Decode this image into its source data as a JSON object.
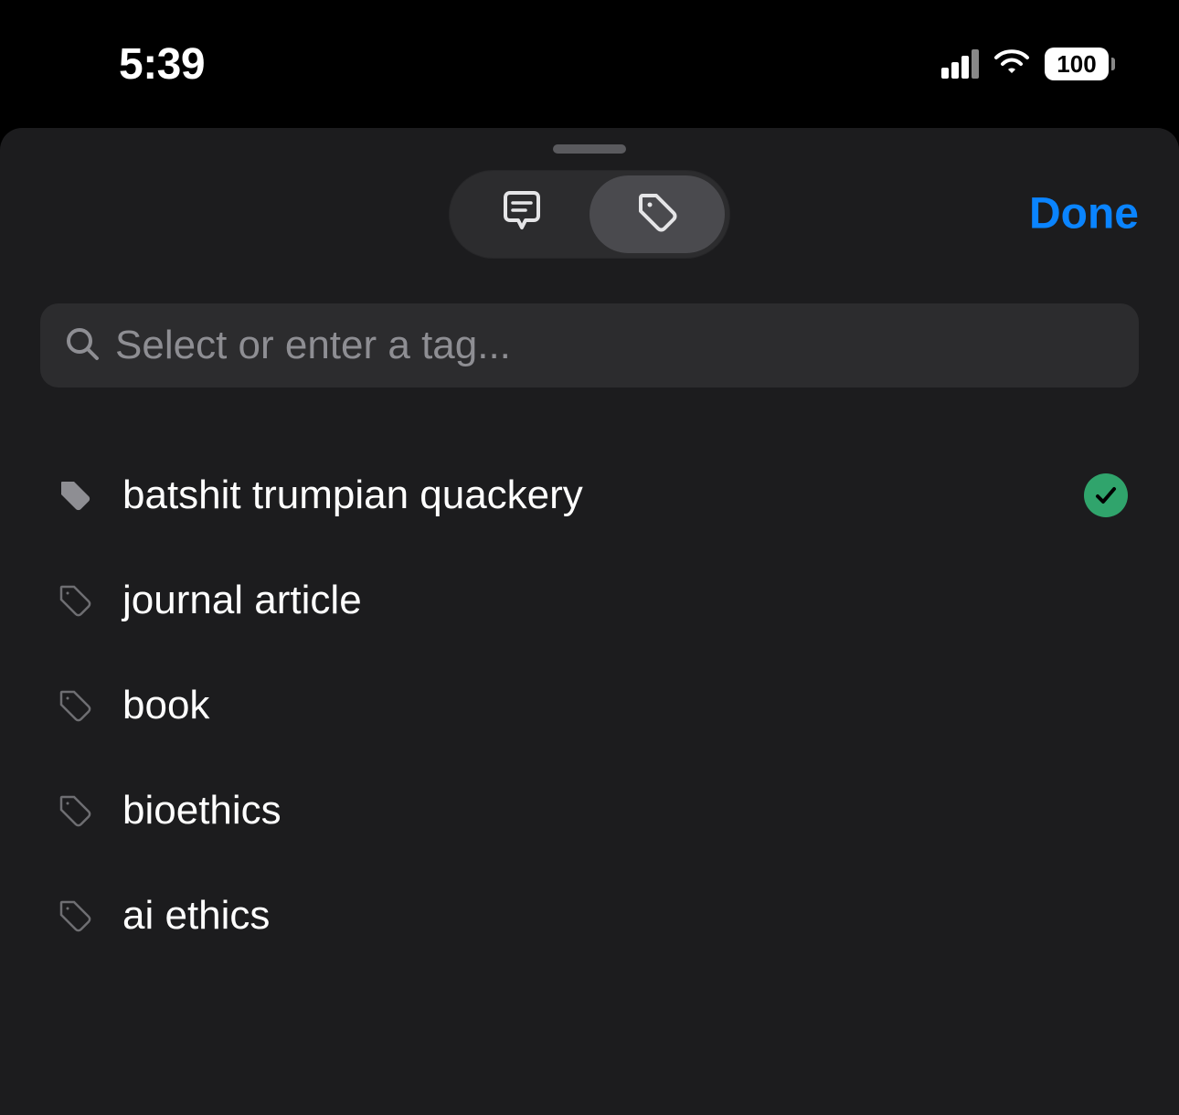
{
  "status_bar": {
    "time": "5:39",
    "battery_pct": "100"
  },
  "header": {
    "done_label": "Done",
    "segments": [
      {
        "id": "notes",
        "active": false
      },
      {
        "id": "tags",
        "active": true
      }
    ]
  },
  "search": {
    "placeholder": "Select or enter a tag..."
  },
  "tags": [
    {
      "label": "batshit trumpian quackery",
      "selected": true
    },
    {
      "label": "journal article",
      "selected": false
    },
    {
      "label": "book",
      "selected": false
    },
    {
      "label": "bioethics",
      "selected": false
    },
    {
      "label": "ai ethics",
      "selected": false
    }
  ],
  "colors": {
    "accent": "#0a84ff",
    "success": "#30a46c"
  }
}
